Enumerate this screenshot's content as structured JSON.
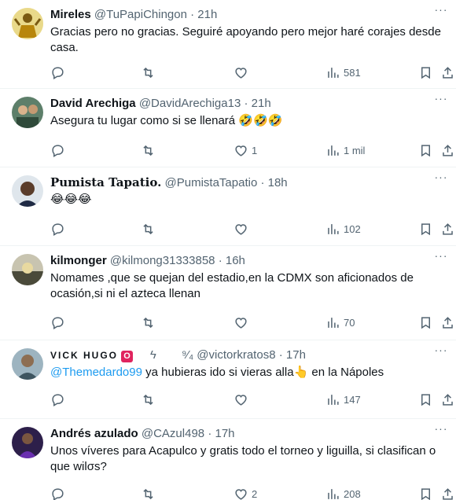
{
  "tweets": [
    {
      "display_name": "Mireles",
      "handle": "@TuPapiChingon",
      "time": "21h",
      "text": "Gracias pero no gracias. Seguiré apoyando pero mejor haré corajes desde casa.",
      "likes": "",
      "views": "581",
      "avatar_color": "#c9a227"
    },
    {
      "display_name": "David Arechiga",
      "handle": "@DavidArechiga13",
      "time": "21h",
      "text": "Asegura tu lugar como si se llenará 🤣🤣🤣",
      "likes": "1",
      "views": "1 mil",
      "avatar_color": "#3b6b4f"
    },
    {
      "display_name": "Pumista Tapatio.",
      "handle": "@PumistaTapatio",
      "time": "18h",
      "text": "😂😂😂",
      "likes": "",
      "views": "102",
      "avatar_color": "#2c3e50"
    },
    {
      "display_name": "kilmonger",
      "handle": "@kilmong31333858",
      "time": "16h",
      "text": "Nomames ,que se quejan del estadio,en la CDMX son aficionados de ocasión,si ni el azteca llenan",
      "likes": "",
      "views": "70",
      "avatar_color": "#8a7a5a"
    },
    {
      "display_name": "VICK HUGO",
      "display_badge": "O",
      "display_extra": "ϟ",
      "handle_prefix": "⁹⁄₄",
      "handle": "@victorkratos8",
      "time": "17h",
      "mention": "@Themedardo99",
      "text": " ya hubieras ido si vieras alla👆 en la Nápoles",
      "likes": "",
      "views": "147",
      "avatar_color": "#5b7a8c"
    },
    {
      "display_name": "Andrés azulado",
      "handle": "@CAzul498",
      "time": "17h",
      "text": "Unos víveres para Acapulco y gratis todo el torneo y liguilla, si clasifican o que wilσs?",
      "likes": "2",
      "views": "208",
      "avatar_color": "#4b2a6e"
    }
  ],
  "dot": "·",
  "more_icon_text": "···",
  "icons": [
    "reply-icon",
    "retweet-icon",
    "like-icon",
    "views-icon",
    "bookmark-icon",
    "share-icon"
  ]
}
